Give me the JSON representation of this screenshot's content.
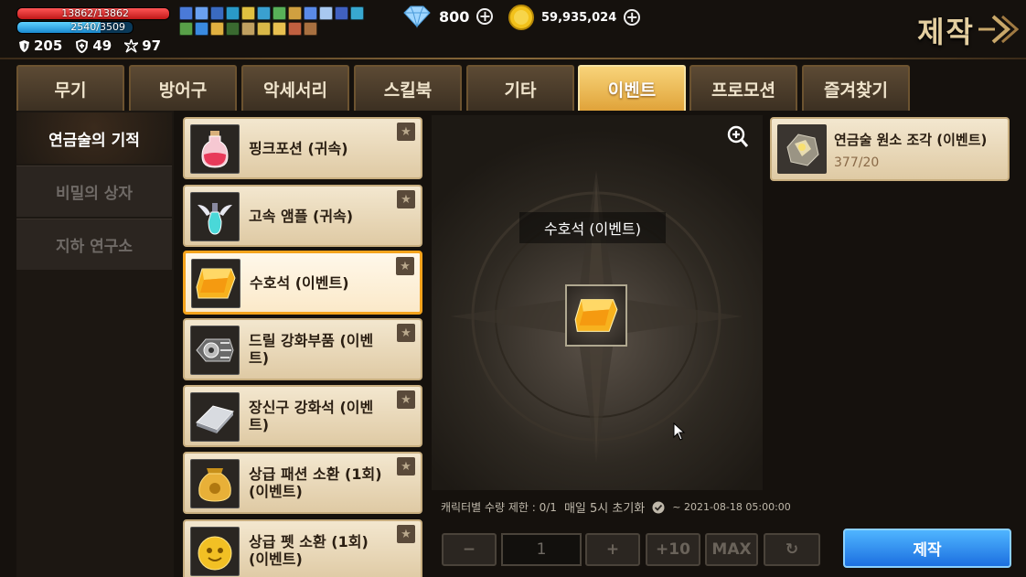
{
  "status": {
    "hp": {
      "text": "13862/13862",
      "fraction": 1.0
    },
    "mp": {
      "text": "2540/3509",
      "fraction": 0.724
    },
    "stats": [
      {
        "icon": "shield-icon",
        "value": "205"
      },
      {
        "icon": "guard-icon",
        "value": "49"
      },
      {
        "icon": "burst-icon",
        "value": "97"
      }
    ]
  },
  "currency": {
    "gems": "800",
    "coins": "59,935,024"
  },
  "header": {
    "title": "제작"
  },
  "tabs": [
    {
      "label": "무기",
      "active": false
    },
    {
      "label": "방어구",
      "active": false
    },
    {
      "label": "악세서리",
      "active": false
    },
    {
      "label": "스킬북",
      "active": false
    },
    {
      "label": "기타",
      "active": false
    },
    {
      "label": "이벤트",
      "active": true
    },
    {
      "label": "프로모션",
      "active": false
    },
    {
      "label": "즐겨찾기",
      "active": false
    }
  ],
  "categories": [
    {
      "label": "연금술의 기적",
      "active": true
    },
    {
      "label": "비밀의 상자",
      "active": false
    },
    {
      "label": "지하 연구소",
      "active": false
    }
  ],
  "items": [
    {
      "name": "핑크포션 (귀속)",
      "icon": "pink-potion-icon"
    },
    {
      "name": "고속 앰플 (귀속)",
      "icon": "winged-ampoule-icon"
    },
    {
      "name": "수호석 (이벤트)",
      "icon": "gold-guardian-stone-icon",
      "active": true
    },
    {
      "name": "드릴 강화부품 (이벤트)",
      "icon": "drill-part-icon"
    },
    {
      "name": "장신구 강화석 (이벤트)",
      "icon": "silver-ingot-icon"
    },
    {
      "name": "상급 패션 소환 (1회) (이벤트)",
      "icon": "gold-bag-icon"
    },
    {
      "name": "상급 펫 소환 (1회) (이벤트)",
      "icon": "gold-pet-icon"
    }
  ],
  "recipe": {
    "selected_name": "수호석 (이벤트)",
    "limit_text": "캐릭터별 수량 제한 : 0/1",
    "reset_text": "매일 5시 초기화",
    "period_text": "~ 2021-08-18 05:00:00"
  },
  "material": {
    "name": "연금술 원소 조각 (이벤트)",
    "count": "377/20"
  },
  "controls": {
    "minus": "−",
    "quantity": "1",
    "plus": "+",
    "plus10": "+10",
    "max": "MAX",
    "refresh": "↻",
    "craft": "제작"
  },
  "colors": {
    "accent_tab": "#f2c062",
    "selected_border": "#f5a31c",
    "craft_button": "#2a8cf0",
    "hp": "#e02a2a",
    "mp": "#37b2f0"
  }
}
